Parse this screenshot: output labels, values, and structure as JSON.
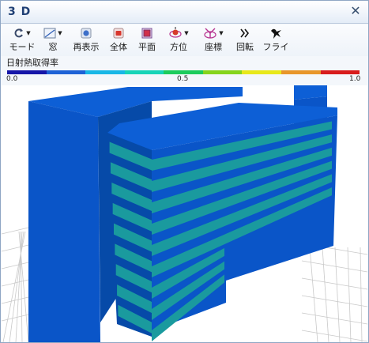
{
  "window": {
    "title": "3 D",
    "close_glyph": "✕"
  },
  "toolbar": {
    "items": [
      {
        "label": "モード",
        "icon": "mode-icon",
        "has_dropdown": true
      },
      {
        "label": "窓",
        "icon": "window-icon",
        "has_dropdown": true
      },
      {
        "label": "再表示",
        "icon": "redisplay-icon",
        "has_dropdown": false
      },
      {
        "label": "全体",
        "icon": "fit-all-icon",
        "has_dropdown": false
      },
      {
        "label": "平面",
        "icon": "plan-view-icon",
        "has_dropdown": false
      },
      {
        "label": "方位",
        "icon": "orientation-icon",
        "has_dropdown": true
      },
      {
        "label": "座標",
        "icon": "coordinates-icon",
        "has_dropdown": true
      },
      {
        "label": "回転",
        "icon": "rotate-icon",
        "has_dropdown": false
      },
      {
        "label": "フライ",
        "icon": "fly-icon",
        "has_dropdown": false
      }
    ],
    "dropdown_glyph": "▼"
  },
  "legend": {
    "title": "日射熱取得率",
    "min_label": "0.0",
    "mid_label": "0.5",
    "max_label": "1.0",
    "colors": [
      "#1616a8",
      "#1e62d6",
      "#19b7e6",
      "#18d4b8",
      "#1ccc5c",
      "#86d41c",
      "#e8e81a",
      "#e8962a",
      "#d81c1c"
    ]
  },
  "scene": {
    "colors": {
      "body": "#0a55c8",
      "body_dark": "#064aa8",
      "roof": "#0d5fd6",
      "window_band": "#1a9a9e"
    }
  }
}
